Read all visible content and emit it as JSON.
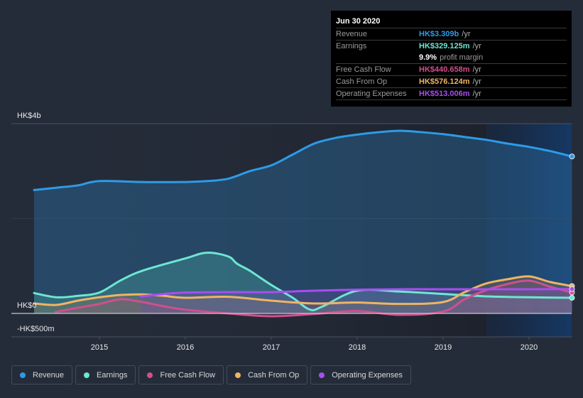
{
  "tooltip": {
    "date": "Jun 30 2020",
    "rows": [
      {
        "label": "Revenue",
        "value": "HK$3.309b",
        "unit": "/yr",
        "color": "#2d9be8"
      },
      {
        "label": "Earnings",
        "value": "HK$329.125m",
        "unit": "/yr",
        "color": "#6ee6d2"
      },
      {
        "label": "",
        "value": "9.9%",
        "unit": "profit margin",
        "color": "#ffffff"
      },
      {
        "label": "Free Cash Flow",
        "value": "HK$440.658m",
        "unit": "/yr",
        "color": "#d14f8e"
      },
      {
        "label": "Cash From Op",
        "value": "HK$576.124m",
        "unit": "/yr",
        "color": "#f0b462"
      },
      {
        "label": "Operating Expenses",
        "value": "HK$513.006m",
        "unit": "/yr",
        "color": "#a84ef0"
      }
    ]
  },
  "legend": [
    {
      "label": "Revenue",
      "color": "#2d9be8"
    },
    {
      "label": "Earnings",
      "color": "#6ee6d2"
    },
    {
      "label": "Free Cash Flow",
      "color": "#d14f8e"
    },
    {
      "label": "Cash From Op",
      "color": "#f0b462"
    },
    {
      "label": "Operating Expenses",
      "color": "#a84ef0"
    }
  ],
  "chart_data": {
    "type": "area",
    "title": "",
    "xlabel": "",
    "ylabel": "",
    "unit": "HK$ millions",
    "xlim": [
      2014.24,
      2020.5
    ],
    "ylim": [
      -500,
      4000
    ],
    "y_tick_labels": [
      {
        "value": 4000,
        "label": "HK$4b"
      },
      {
        "value": 0,
        "label": "HK$0"
      },
      {
        "value": -500,
        "label": "-HK$500m"
      }
    ],
    "x_tick_labels": [
      "2015",
      "2016",
      "2017",
      "2018",
      "2019",
      "2020"
    ],
    "x_ticks": [
      2015,
      2016,
      2017,
      2018,
      2019,
      2020
    ],
    "forecast_shade_start": 2019.5,
    "grid": true,
    "legend_position": "bottom-left",
    "series": [
      {
        "name": "Revenue",
        "color": "#2d9be8",
        "x": [
          2014.24,
          2014.5,
          2014.75,
          2015.0,
          2015.5,
          2016.0,
          2016.25,
          2016.5,
          2016.75,
          2017.0,
          2017.25,
          2017.5,
          2017.75,
          2018.0,
          2018.25,
          2018.5,
          2018.75,
          2019.0,
          2019.25,
          2019.5,
          2019.75,
          2020.0,
          2020.25,
          2020.5
        ],
        "values": [
          2600,
          2650,
          2700,
          2790,
          2770,
          2770,
          2790,
          2840,
          3000,
          3120,
          3350,
          3580,
          3700,
          3770,
          3820,
          3850,
          3820,
          3780,
          3720,
          3660,
          3580,
          3510,
          3420,
          3309
        ]
      },
      {
        "name": "Earnings",
        "color": "#6ee6d2",
        "x": [
          2014.24,
          2014.5,
          2014.75,
          2015.0,
          2015.25,
          2015.5,
          2016.0,
          2016.25,
          2016.5,
          2016.6,
          2016.75,
          2017.0,
          2017.25,
          2017.45,
          2017.6,
          2018.0,
          2018.5,
          2019.0,
          2019.5,
          2020.0,
          2020.5
        ],
        "values": [
          430,
          340,
          370,
          440,
          700,
          900,
          1160,
          1280,
          1200,
          1050,
          900,
          600,
          330,
          80,
          150,
          480,
          460,
          410,
          360,
          340,
          329
        ]
      },
      {
        "name": "Free Cash Flow",
        "color": "#d14f8e",
        "x": [
          2014.49,
          2014.75,
          2015.0,
          2015.25,
          2015.5,
          2015.75,
          2016.0,
          2016.5,
          2017.0,
          2017.5,
          2018.0,
          2018.5,
          2019.0,
          2019.25,
          2019.5,
          2019.75,
          2020.0,
          2020.25,
          2020.5
        ],
        "values": [
          30,
          120,
          200,
          300,
          240,
          150,
          80,
          0,
          -60,
          -10,
          50,
          -30,
          40,
          300,
          490,
          620,
          690,
          560,
          441
        ]
      },
      {
        "name": "Cash From Op",
        "color": "#f0b462",
        "x": [
          2014.24,
          2014.5,
          2014.75,
          2015.0,
          2015.25,
          2015.5,
          2015.75,
          2016.0,
          2016.5,
          2017.0,
          2017.5,
          2018.0,
          2018.5,
          2019.0,
          2019.25,
          2019.5,
          2019.75,
          2020.0,
          2020.25,
          2020.5
        ],
        "values": [
          210,
          180,
          270,
          340,
          390,
          400,
          370,
          330,
          350,
          270,
          210,
          230,
          200,
          240,
          450,
          630,
          720,
          780,
          660,
          576
        ]
      },
      {
        "name": "Operating Expenses",
        "color": "#a84ef0",
        "x": [
          2015.48,
          2015.75,
          2016.0,
          2016.5,
          2017.0,
          2017.5,
          2018.0,
          2018.5,
          2019.0,
          2019.5,
          2020.0,
          2020.5
        ],
        "values": [
          360,
          410,
          440,
          450,
          450,
          480,
          500,
          510,
          510,
          510,
          510,
          513
        ]
      }
    ]
  }
}
